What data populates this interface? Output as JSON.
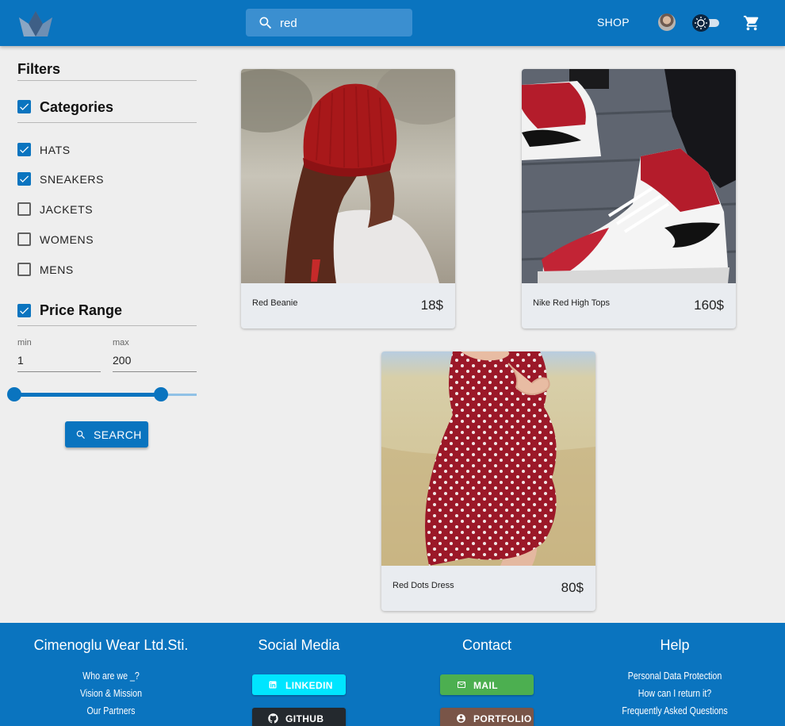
{
  "header": {
    "search_value": "red",
    "shop_label": "SHOP"
  },
  "filters": {
    "title": "Filters",
    "categories": {
      "title": "Categories",
      "checked": true,
      "items": [
        {
          "label": "HATS",
          "checked": true
        },
        {
          "label": "SNEAKERS",
          "checked": true
        },
        {
          "label": "JACKETS",
          "checked": false
        },
        {
          "label": "WOMENS",
          "checked": false
        },
        {
          "label": "MENS",
          "checked": false
        }
      ]
    },
    "price_range": {
      "title": "Price Range",
      "checked": true,
      "min_label": "min",
      "min_value": "1",
      "max_label": "max",
      "max_value": "200"
    },
    "search_button": "SEARCH"
  },
  "products": [
    {
      "name": "Red Beanie",
      "price": "18$"
    },
    {
      "name": "Nike Red High Tops",
      "price": "160$"
    },
    {
      "name": "Red Dots Dress",
      "price": "80$"
    }
  ],
  "footer": {
    "company": {
      "title": "Cimenoglu Wear Ltd.Sti.",
      "links": [
        "Who are we _?",
        "Vision & Mission",
        "Our Partners"
      ]
    },
    "social": {
      "title": "Social Media",
      "linkedin": "LINKEDIN",
      "github": "GITHUB"
    },
    "contact": {
      "title": "Contact",
      "mail": "MAIL",
      "portfolio": "PORTFOLIO"
    },
    "help": {
      "title": "Help",
      "links": [
        "Personal Data Protection",
        "How can I return it?",
        "Frequently Asked Questions"
      ]
    }
  },
  "colors": {
    "primary": "#0a74bf",
    "linkedin": "#00e5ff",
    "github": "#24292e",
    "mail": "#4caf50",
    "portfolio": "#795548"
  }
}
